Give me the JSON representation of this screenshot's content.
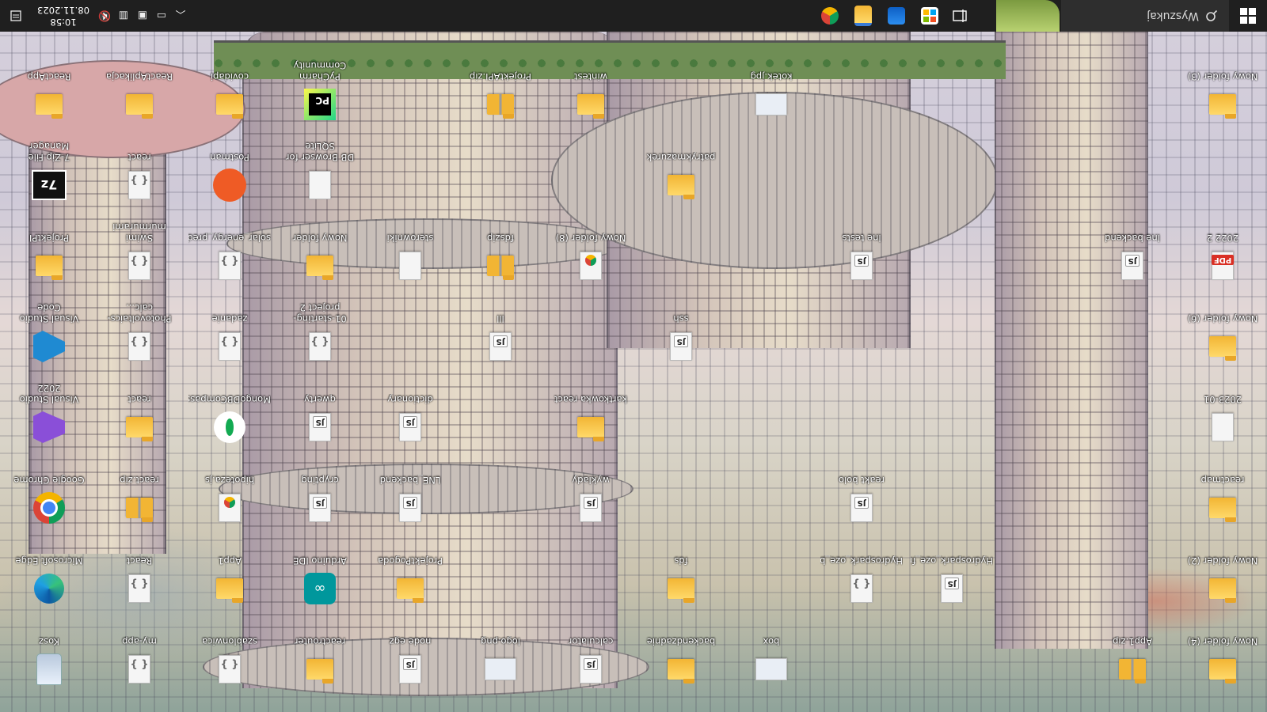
{
  "taskbar": {
    "search_placeholder": "Wyszukaj",
    "time": "10:58",
    "date": "08.11.2023",
    "pinned": [
      "Widoki zadań",
      "Microsoft Store",
      "Poczta",
      "Eksplorator plików",
      "Google Chrome"
    ]
  },
  "desktop": {
    "icons": [
      {
        "label": "Kosz",
        "type": "bin"
      },
      {
        "label": "Microsoft Edge",
        "type": "edge"
      },
      {
        "label": "Google Chrome",
        "type": "chrome"
      },
      {
        "label": "Visual Studio 2022",
        "type": "vs"
      },
      {
        "label": "Visual Studio Code",
        "type": "vscode"
      },
      {
        "label": "ProjektPI",
        "type": "folder"
      },
      {
        "label": "7-Zip File Manager",
        "type": "7zip"
      },
      {
        "label": "ReactApp",
        "type": "folder"
      },
      {
        "label": "my-app",
        "type": "json"
      },
      {
        "label": "React",
        "type": "json"
      },
      {
        "label": "react.zip",
        "type": "zip"
      },
      {
        "label": "react",
        "type": "folder"
      },
      {
        "label": "Photovoltaics-calc...",
        "type": "json"
      },
      {
        "label": "Swimi murmurami PESEL",
        "type": "json"
      },
      {
        "label": "react",
        "type": "json"
      },
      {
        "label": "ReactAplikacja",
        "type": "folder"
      },
      {
        "label": "szablonwica",
        "type": "json"
      },
      {
        "label": "App1",
        "type": "folder"
      },
      {
        "label": "hipoteza.js",
        "type": "chrome-doc"
      },
      {
        "label": "MongoDBCompass",
        "type": "mongo"
      },
      {
        "label": "zadanie",
        "type": "json"
      },
      {
        "label": "solar_energy_predi...",
        "type": "json"
      },
      {
        "label": "Postman",
        "type": "postman"
      },
      {
        "label": "covidapi",
        "type": "folder"
      },
      {
        "label": "reactrouter",
        "type": "folder"
      },
      {
        "label": "Arduino IDE",
        "type": "arduino"
      },
      {
        "label": "crypting",
        "type": "js"
      },
      {
        "label": "qwerty",
        "type": "js"
      },
      {
        "label": "01-starting-project 2",
        "type": "json"
      },
      {
        "label": "Nowy folder",
        "type": "folder"
      },
      {
        "label": "DB Browser for SQLite",
        "type": "doc"
      },
      {
        "label": "PyCharm Community Editi...",
        "type": "pycharm"
      },
      {
        "label": "node egz",
        "type": "js"
      },
      {
        "label": "ProjektPogoda",
        "type": "folder"
      },
      {
        "label": "LNE_backend",
        "type": "js"
      },
      {
        "label": "dictionary",
        "type": "js"
      },
      {
        "label": "sterowniki",
        "type": "doc"
      },
      {
        "label": "logo.png",
        "type": "image"
      },
      {
        "label": "lll",
        "type": "js"
      },
      {
        "label": "fdszip",
        "type": "zip"
      },
      {
        "label": "ProjektAPI.zip",
        "type": "zip"
      },
      {
        "label": "calculator",
        "type": "js"
      },
      {
        "label": "wyklady",
        "type": "js"
      },
      {
        "label": "kartkowka react",
        "type": "folder"
      },
      {
        "label": "Nowy folder (8)",
        "type": "chrome-doc"
      },
      {
        "label": "wintest",
        "type": "folder"
      },
      {
        "label": "backendzadnie",
        "type": "folder"
      },
      {
        "label": "fds",
        "type": "folder"
      },
      {
        "label": "ssh",
        "type": "js"
      },
      {
        "label": "patrykmazurek",
        "type": "folder"
      },
      {
        "label": "box",
        "type": "image"
      },
      {
        "label": "kotek.jpg",
        "type": "image"
      },
      {
        "label": "Hydrospark_oze_b...",
        "type": "json"
      },
      {
        "label": "reakt bolo",
        "type": "js"
      },
      {
        "label": "lne tests",
        "type": "js"
      },
      {
        "label": "Hydrospark_oze_fr...",
        "type": "js"
      },
      {
        "label": "App1.zip",
        "type": "zip"
      },
      {
        "label": "lne backend",
        "type": "js"
      },
      {
        "label": "Nowy folder (4)",
        "type": "folder"
      },
      {
        "label": "Nowy folder (2)",
        "type": "folder"
      },
      {
        "label": "reactmap",
        "type": "folder"
      },
      {
        "label": "2023-01",
        "type": "doc"
      },
      {
        "label": "Nowy folder (6)",
        "type": "folder"
      },
      {
        "label": "2022 2",
        "type": "pdf"
      },
      {
        "label": "Nowy folder (3)",
        "type": "folder"
      }
    ]
  }
}
